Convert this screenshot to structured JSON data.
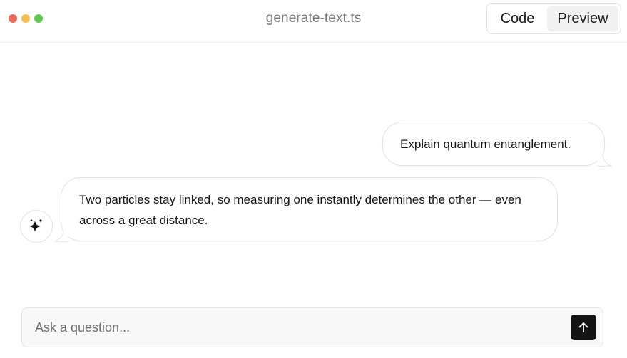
{
  "window": {
    "title": "generate-text.ts"
  },
  "view_toggle": {
    "code_label": "Code",
    "preview_label": "Preview",
    "selected": "Preview"
  },
  "chat": {
    "user_message": "Explain quantum entanglement.",
    "assistant_message": "Two particles stay linked, so measuring one instantly determines the other — even across a great distance.",
    "assistant_avatar_icon": "sparkles-icon"
  },
  "composer": {
    "placeholder": "Ask a question...",
    "value": "",
    "send_icon": "arrow-up-icon"
  },
  "colors": {
    "traffic_close": "#ed6a5e",
    "traffic_minimize": "#f4bf4f",
    "traffic_maximize": "#61c554",
    "send_button": "#141414"
  }
}
